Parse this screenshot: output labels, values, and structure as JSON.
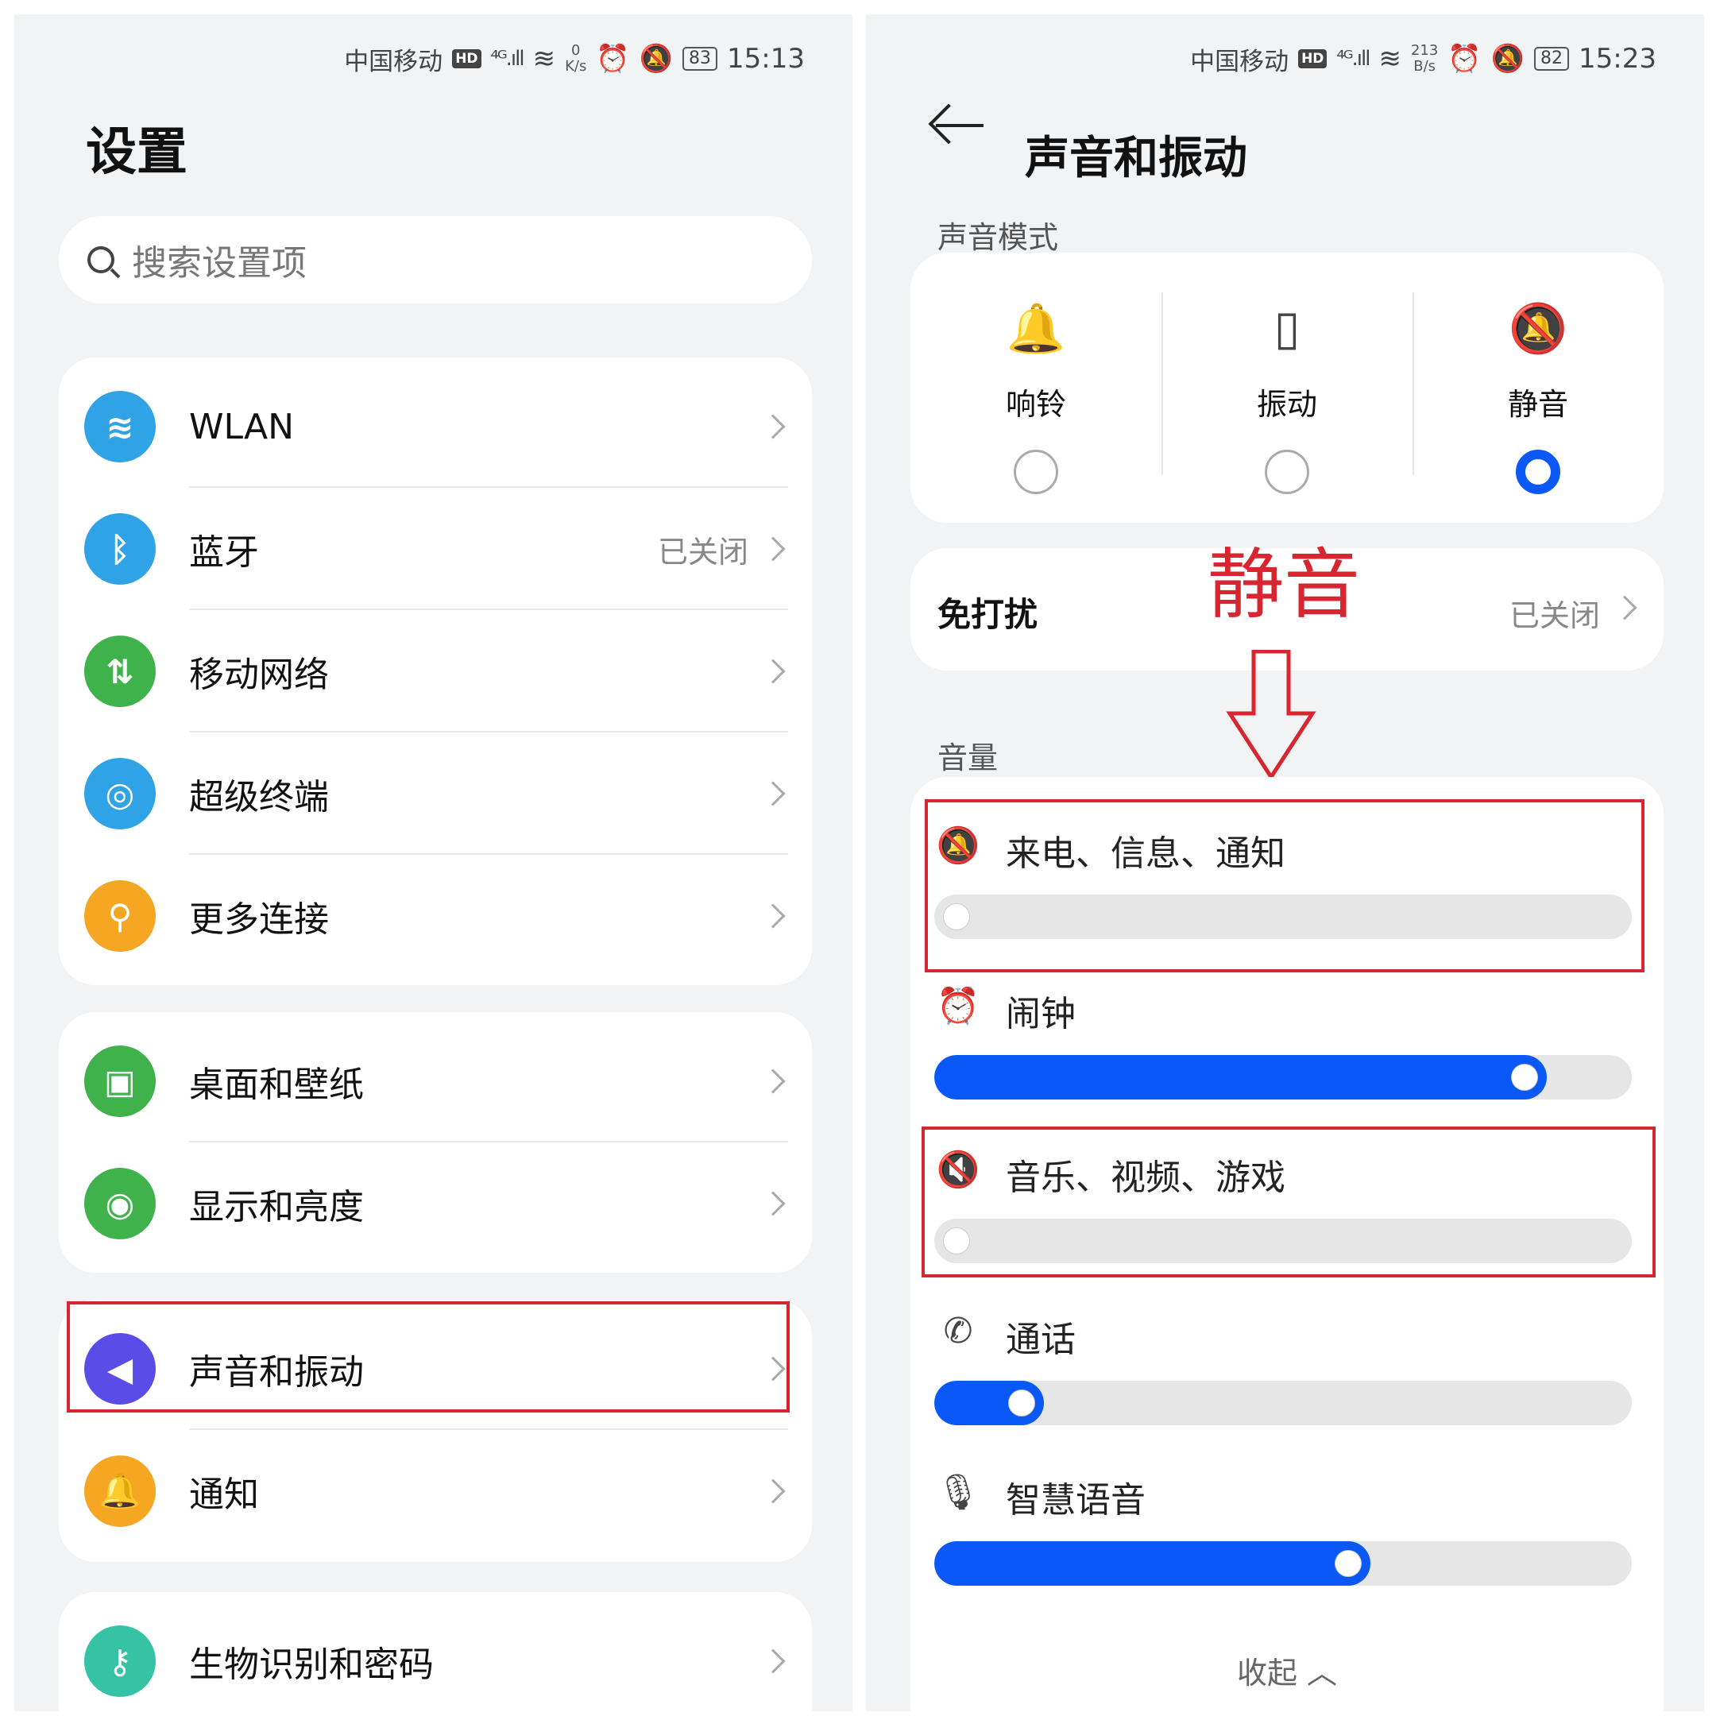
{
  "left": {
    "status": {
      "carrier": "中国移动",
      "hd": "HD",
      "signal": "⁴ᴳ.ıll",
      "speed_value": "0",
      "speed_unit": "K/s",
      "battery": "83",
      "time": "15:13"
    },
    "title": "设置",
    "search_placeholder": "搜索设置项",
    "groups": [
      [
        {
          "label": "WLAN",
          "value": "",
          "color": "#2fa3e6",
          "icon": "wifi-icon"
        },
        {
          "label": "蓝牙",
          "value": "已关闭",
          "color": "#2fa3e6",
          "icon": "bluetooth-icon"
        },
        {
          "label": "移动网络",
          "value": "",
          "color": "#3fb24c",
          "icon": "mobile-data-icon"
        },
        {
          "label": "超级终端",
          "value": "",
          "color": "#2fa3e6",
          "icon": "super-device-icon"
        },
        {
          "label": "更多连接",
          "value": "",
          "color": "#f5a623",
          "icon": "link-icon"
        }
      ],
      [
        {
          "label": "桌面和壁纸",
          "value": "",
          "color": "#3fb24c",
          "icon": "wallpaper-icon"
        },
        {
          "label": "显示和亮度",
          "value": "",
          "color": "#3fb24c",
          "icon": "eye-icon"
        }
      ],
      [
        {
          "label": "声音和振动",
          "value": "",
          "color": "#5a4ce6",
          "icon": "speaker-icon"
        },
        {
          "label": "通知",
          "value": "",
          "color": "#f5a623",
          "icon": "bell-icon"
        }
      ],
      [
        {
          "label": "生物识别和密码",
          "value": "",
          "color": "#35c2a5",
          "icon": "key-icon"
        }
      ]
    ]
  },
  "right": {
    "status": {
      "carrier": "中国移动",
      "hd": "HD",
      "signal": "⁴ᴳ.ıll",
      "speed_value": "213",
      "speed_unit": "B/s",
      "battery": "82",
      "time": "15:23"
    },
    "title": "声音和振动",
    "mode_section": "声音模式",
    "modes": [
      {
        "label": "响铃",
        "icon": "bell-icon",
        "selected": false
      },
      {
        "label": "振动",
        "icon": "vibrate-icon",
        "selected": false
      },
      {
        "label": "静音",
        "icon": "bell-off-icon",
        "selected": true
      }
    ],
    "dnd": {
      "label": "免打扰",
      "value": "已关闭"
    },
    "volume_section": "音量",
    "volumes": [
      {
        "label": "来电、信息、通知",
        "icon": "bell-off-icon",
        "level": 0
      },
      {
        "label": "闹钟",
        "icon": "alarm-icon",
        "level": 0.87
      },
      {
        "label": "音乐、视频、游戏",
        "icon": "speaker-muted-icon",
        "level": 0
      },
      {
        "label": "通话",
        "icon": "phone-icon",
        "level": 0.1
      },
      {
        "label": "智慧语音",
        "icon": "microphone-icon",
        "level": 0.6
      }
    ],
    "collapse_label": "收起",
    "annotation": "静音",
    "accent": "#0a59f7",
    "highlight_color": "#d7262f"
  }
}
